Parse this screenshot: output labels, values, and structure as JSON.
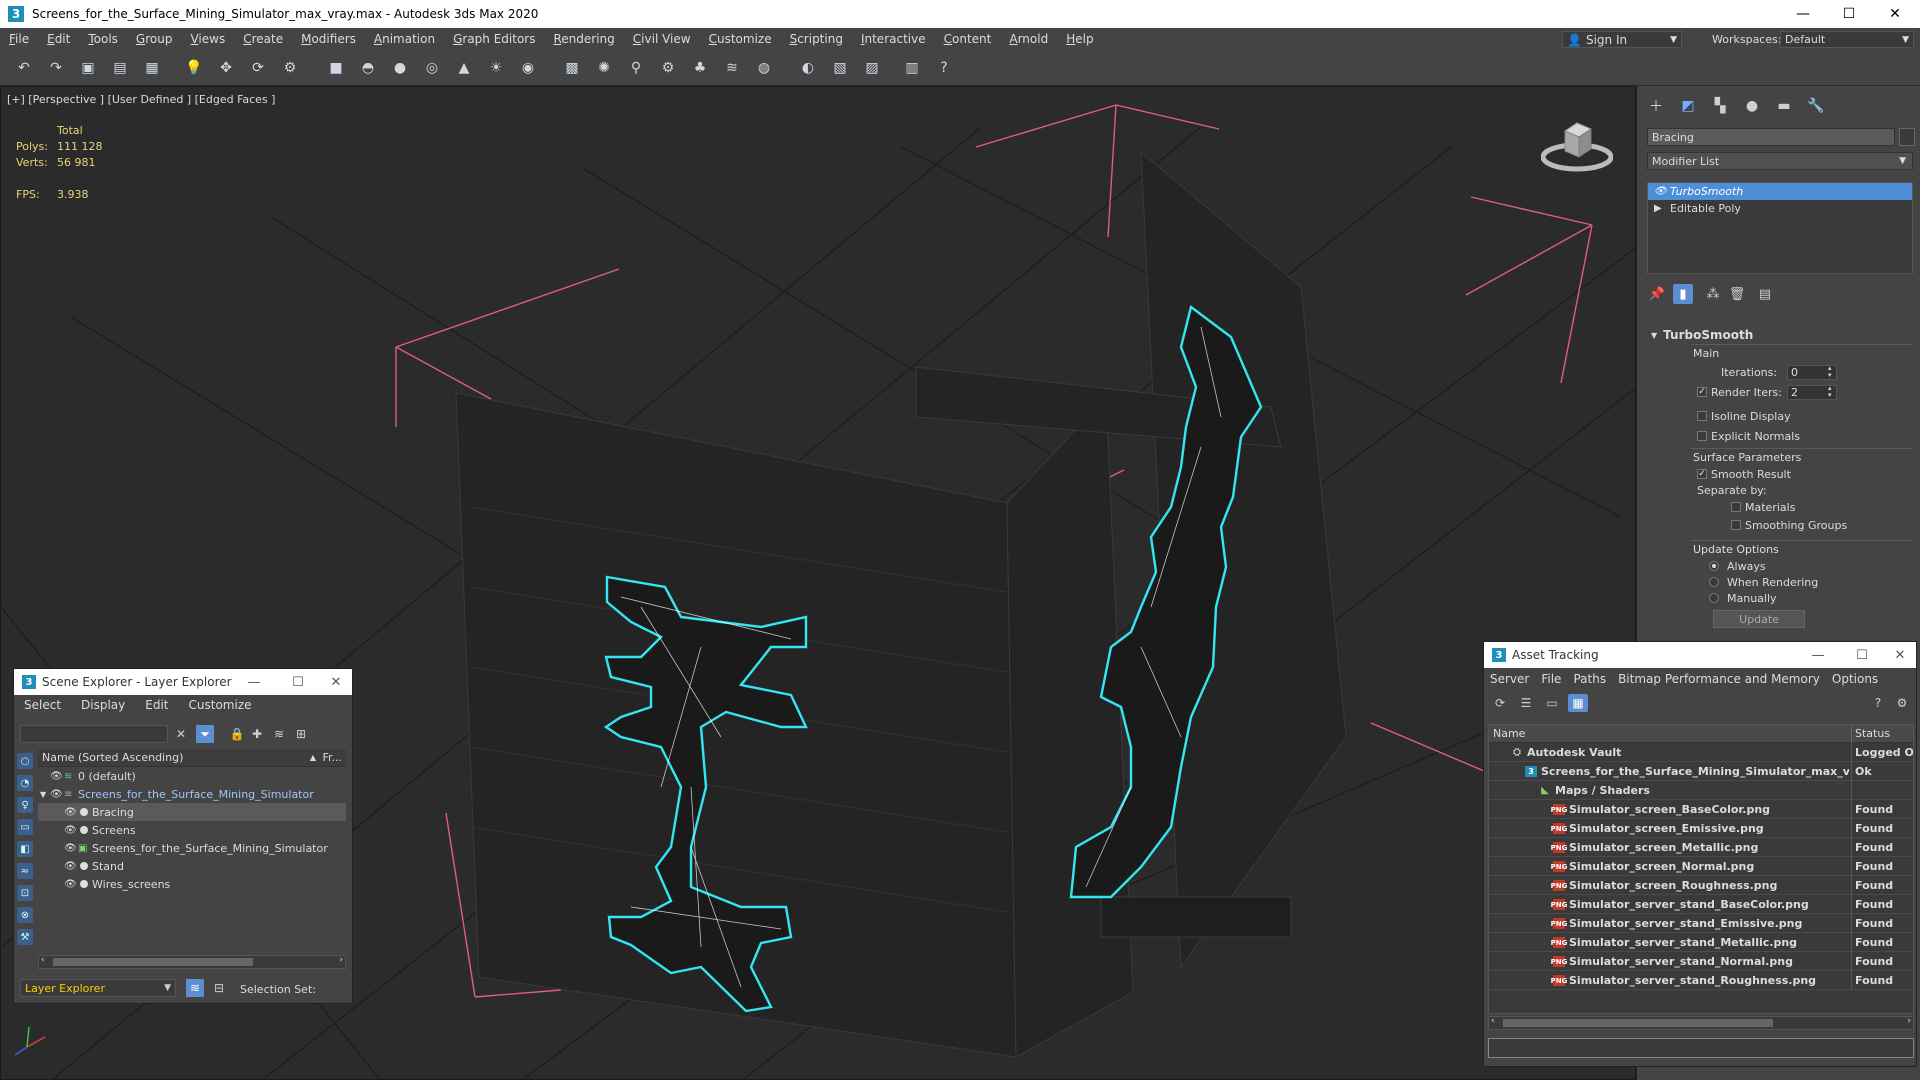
{
  "window": {
    "title": "Screens_for_the_Surface_Mining_Simulator_max_vray.max - Autodesk 3ds Max 2020",
    "app_icon": "3",
    "controls": [
      "—",
      "☐",
      "✕"
    ]
  },
  "menubar": {
    "items": [
      "File",
      "Edit",
      "Tools",
      "Group",
      "Views",
      "Create",
      "Modifiers",
      "Animation",
      "Graph Editors",
      "Rendering",
      "Civil View",
      "Customize",
      "Scripting",
      "Interactive",
      "Content",
      "Arnold",
      "Help"
    ],
    "sign_in": "Sign In",
    "workspaces_label": "Workspaces:",
    "workspace_value": "Default"
  },
  "viewport": {
    "label": "[+] [Perspective ] [User Defined ] [Edged Faces ]",
    "stats": {
      "header": "Total",
      "polys_label": "Polys:",
      "polys_value": "111 128",
      "verts_label": "Verts:",
      "verts_value": "56 981",
      "fps_label": "FPS:",
      "fps_value": "3.938"
    }
  },
  "command_panel": {
    "object_name": "Bracing",
    "modifier_list": "Modifier List",
    "stack": [
      "TurboSmooth",
      "Editable Poly"
    ],
    "rollout_title": "TurboSmooth",
    "main_label": "Main",
    "iterations_label": "Iterations:",
    "iterations_value": "0",
    "render_iters_label": "Render Iters:",
    "render_iters_value": "2",
    "isoline_label": "Isoline Display",
    "explicit_normals_label": "Explicit Normals",
    "surface_params_label": "Surface Parameters",
    "smooth_result_label": "Smooth Result",
    "separate_by_label": "Separate by:",
    "materials_label": "Materials",
    "smoothing_groups_label": "Smoothing Groups",
    "update_options_label": "Update Options",
    "always_label": "Always",
    "when_rendering_label": "When Rendering",
    "manually_label": "Manually",
    "update_button": "Update"
  },
  "scene_explorer": {
    "title": "Scene Explorer - Layer Explorer",
    "menu": [
      "Select",
      "Display",
      "Edit",
      "Customize"
    ],
    "column_name": "Name (Sorted Ascending)",
    "column_fr": "Fr...",
    "tree": [
      {
        "label": "0 (default)"
      },
      {
        "label": "Screens_for_the_Surface_Mining_Simulator"
      },
      {
        "label": "Bracing"
      },
      {
        "label": "Screens"
      },
      {
        "label": "Screens_for_the_Surface_Mining_Simulator"
      },
      {
        "label": "Stand"
      },
      {
        "label": "Wires_screens"
      }
    ],
    "layer_select": "Layer Explorer",
    "selection_set_label": "Selection Set:"
  },
  "asset_tracking": {
    "title": "Asset Tracking",
    "menu": [
      "Server",
      "File",
      "Paths",
      "Bitmap Performance and Memory",
      "Options"
    ],
    "col_name": "Name",
    "col_status": "Status",
    "rows": [
      {
        "name": "Autodesk Vault",
        "status": "Logged Out",
        "icon": "vault"
      },
      {
        "name": "Screens_for_the_Surface_Mining_Simulator_max_vray.max",
        "status": "Ok",
        "icon": "max"
      },
      {
        "name": "Maps / Shaders",
        "status": "",
        "icon": "maps"
      },
      {
        "name": "Simulator_screen_BaseColor.png",
        "status": "Found",
        "icon": "png"
      },
      {
        "name": "Simulator_screen_Emissive.png",
        "status": "Found",
        "icon": "png"
      },
      {
        "name": "Simulator_screen_Metallic.png",
        "status": "Found",
        "icon": "png"
      },
      {
        "name": "Simulator_screen_Normal.png",
        "status": "Found",
        "icon": "png"
      },
      {
        "name": "Simulator_screen_Roughness.png",
        "status": "Found",
        "icon": "png"
      },
      {
        "name": "Simulator_server_stand_BaseColor.png",
        "status": "Found",
        "icon": "png"
      },
      {
        "name": "Simulator_server_stand_Emissive.png",
        "status": "Found",
        "icon": "png"
      },
      {
        "name": "Simulator_server_stand_Metallic.png",
        "status": "Found",
        "icon": "png"
      },
      {
        "name": "Simulator_server_stand_Normal.png",
        "status": "Found",
        "icon": "png"
      },
      {
        "name": "Simulator_server_stand_Roughness.png",
        "status": "Found",
        "icon": "png"
      }
    ]
  },
  "colors": {
    "selection_outline": "#33e6f2",
    "bounding_box": "#e05a8a",
    "accent_blue": "#4d8fd6",
    "stats_yellow": "#e7d57a",
    "layer_yellow": "#f5d100"
  }
}
